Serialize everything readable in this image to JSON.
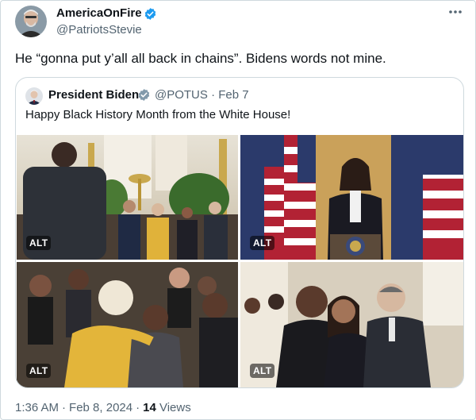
{
  "author": {
    "name": "AmericaOnFire",
    "handle": "@PatriotsStevie",
    "verified": true
  },
  "tweet": {
    "text": "He “gonna put y’all all back in chains”. Bidens words not mine."
  },
  "quoted_tweet": {
    "name": "President Biden",
    "handle": "@POTUS",
    "date": "Feb 7",
    "verified": true,
    "text": "Happy Black History Month from the White House!",
    "photos": [
      {
        "alt_label": "ALT"
      },
      {
        "alt_label": "ALT"
      },
      {
        "alt_label": "ALT"
      },
      {
        "alt_label": "ALT"
      }
    ]
  },
  "meta": {
    "time": "1:36 AM",
    "date": "Feb 8, 2024",
    "views_count": "14",
    "views_label": "Views"
  },
  "icons": {
    "verified": "verified-badge-icon",
    "more": "more-options-icon"
  },
  "colors": {
    "verified": "#1d9bf0",
    "secondary_text": "#536471",
    "primary_text": "#0f1419",
    "border": "#cfd9de"
  }
}
